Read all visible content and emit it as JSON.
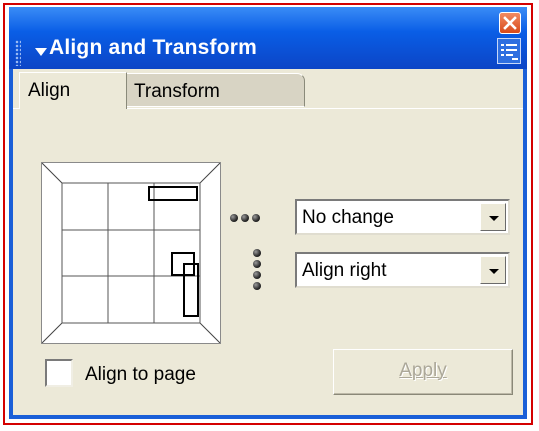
{
  "window": {
    "title": "Align and Transform",
    "close_icon": "close-icon",
    "menu_icon": "panel-menu-icon",
    "accent": "#0b4fd3"
  },
  "tabs": [
    {
      "label": "Align",
      "active": true
    },
    {
      "label": "Transform",
      "active": false
    }
  ],
  "align": {
    "horizontal_select": {
      "value": "No change",
      "icon": "horizontal-distribution-icon"
    },
    "vertical_select": {
      "value": "Align right",
      "icon": "vertical-distribution-icon"
    },
    "grid_icon": "alignment-preview-grid"
  },
  "footer": {
    "align_to_page_label": "Align to page",
    "align_to_page_checked": false,
    "apply_label": "Apply",
    "apply_enabled": false
  }
}
